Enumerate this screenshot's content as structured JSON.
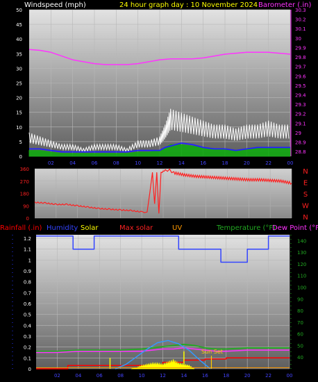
{
  "header": {
    "windspeed_label": "Windspeed (mph)",
    "title": "24 hour graph day : 10 November 2024",
    "barometer_label": "Barometer (.in)"
  },
  "colors": {
    "windspeed_label": "#ffffff",
    "title": "#ffff00",
    "barometer": "#ff33ff",
    "wind_gust": "#ffffff",
    "wind_avg": "#11aa11",
    "wind_dir_line": "#2222ff",
    "direction": "#ff2020",
    "rain": "#ff0000",
    "humidity": "#3344ff",
    "solar": "#ffff00",
    "max_solar": "#3399ff",
    "uv": "#ff9900",
    "temperature": "#22aa22",
    "dew_point": "#ff33ff",
    "sunset": "#ffcc00"
  },
  "chart_data": [
    {
      "type": "line",
      "name": "wind-barometer",
      "x_ticks": [
        "02",
        "04",
        "06",
        "08",
        "10",
        "12",
        "14",
        "16",
        "18",
        "20",
        "22",
        "00"
      ],
      "y_left": {
        "label": "Windspeed (mph)",
        "ticks": [
          "0",
          "5",
          "10",
          "15",
          "20",
          "25",
          "30",
          "35",
          "40",
          "45",
          "50"
        ],
        "lim": [
          0,
          50
        ]
      },
      "y_right": {
        "label": "Barometer (.in)",
        "ticks": [
          "28.8",
          "28.9",
          "29",
          "29.1",
          "29.2",
          "29.3",
          "29.4",
          "29.5",
          "29.6",
          "29.7",
          "29.8",
          "29.9",
          "30",
          "30.1",
          "30.2",
          "30.3"
        ],
        "lim": [
          28.75,
          30.3
        ]
      },
      "series": [
        {
          "key": "barometer",
          "axis": "right",
          "x": [
            0,
            1,
            2,
            3,
            4,
            5,
            6,
            7,
            8,
            9,
            10,
            11,
            12,
            13,
            14,
            15,
            16,
            17,
            18,
            19,
            20,
            21,
            22,
            23,
            24
          ],
          "values": [
            29.88,
            29.87,
            29.85,
            29.81,
            29.77,
            29.75,
            29.73,
            29.72,
            29.72,
            29.72,
            29.73,
            29.75,
            29.77,
            29.78,
            29.78,
            29.78,
            29.79,
            29.81,
            29.83,
            29.84,
            29.85,
            29.85,
            29.85,
            29.84,
            29.83
          ]
        },
        {
          "key": "wind_gust",
          "axis": "left",
          "x": [
            0,
            1,
            2,
            3,
            4,
            5,
            6,
            7,
            8,
            9,
            10,
            11,
            12,
            12.5,
            13,
            14,
            15,
            16,
            17,
            18,
            19,
            20,
            21,
            22,
            23,
            24
          ],
          "values": [
            6,
            5,
            4,
            3,
            3,
            2,
            3,
            3,
            3,
            2,
            4,
            4,
            5,
            8,
            12,
            11,
            10,
            9,
            8,
            8,
            7,
            8,
            8,
            9,
            8,
            8
          ]
        },
        {
          "key": "wind_avg",
          "axis": "left",
          "x": [
            0,
            1,
            2,
            3,
            4,
            5,
            6,
            7,
            8,
            9,
            10,
            11,
            12,
            12.5,
            13,
            14,
            15,
            16,
            17,
            18,
            19,
            20,
            21,
            22,
            23,
            24
          ],
          "values": [
            2,
            2,
            1.5,
            1,
            1,
            1,
            1,
            1,
            1,
            1,
            1.5,
            1.5,
            2,
            3,
            4,
            4,
            3.5,
            3,
            2.5,
            2.5,
            2,
            2.5,
            3,
            3,
            3,
            3
          ]
        },
        {
          "key": "wind_dir_line",
          "axis": "left",
          "x": [
            0,
            1,
            2,
            3,
            4,
            5,
            6,
            7,
            8,
            9,
            10,
            11,
            12,
            12.5,
            13,
            14,
            15,
            16,
            17,
            18,
            19,
            20,
            21,
            22,
            23,
            24
          ],
          "values": [
            2.5,
            2.5,
            2,
            1.5,
            1.5,
            1.5,
            1.5,
            1.5,
            1.5,
            1.5,
            2,
            2,
            2,
            3,
            3.5,
            4.5,
            4,
            3,
            2.5,
            2.5,
            2,
            2.5,
            3,
            3,
            3,
            3
          ]
        }
      ]
    },
    {
      "type": "line",
      "name": "wind-direction",
      "x_ticks": [
        "02",
        "04",
        "06",
        "08",
        "10",
        "12",
        "14",
        "16",
        "18",
        "20",
        "22",
        "00"
      ],
      "y_left": {
        "ticks": [
          "0",
          "90",
          "180",
          "270",
          "360"
        ],
        "lim": [
          0,
          360
        ]
      },
      "y_right": {
        "ticks": [
          "N",
          "W",
          "S",
          "E",
          "N"
        ]
      },
      "series": [
        {
          "key": "direction",
          "x": [
            0,
            1,
            2,
            3,
            4,
            5,
            6,
            7,
            8,
            9,
            10,
            10.5,
            11,
            11.2,
            11.4,
            11.6,
            11.8,
            12,
            12.2,
            12.6,
            13,
            14,
            15,
            16,
            17,
            18,
            19,
            20,
            21,
            22,
            23,
            24
          ],
          "values": [
            115,
            110,
            100,
            100,
            90,
            80,
            70,
            65,
            60,
            55,
            45,
            40,
            330,
            100,
            330,
            30,
            330,
            340,
            350,
            350,
            330,
            315,
            305,
            300,
            295,
            290,
            285,
            280,
            280,
            275,
            270,
            255
          ]
        }
      ]
    },
    {
      "type": "line",
      "name": "rain-humidity-temp",
      "x_ticks": [
        "02",
        "04",
        "06",
        "08",
        "10",
        "12",
        "14",
        "16",
        "18",
        "20",
        "22",
        "00"
      ],
      "y_left": {
        "label": "Rainfall (.in)",
        "ticks": [
          "0",
          "0.1",
          "0.2",
          "0.3",
          "0.4",
          "0.5",
          "0.6",
          "0.7",
          "0.8",
          "0.9",
          "1",
          "1.1",
          "1.2"
        ],
        "lim": [
          0,
          1.2
        ]
      },
      "y_right": {
        "label": "Temperature (°F)",
        "ticks": [
          "40",
          "50",
          "60",
          "70",
          "80",
          "90",
          "100",
          "110",
          "120",
          "130",
          "140"
        ],
        "lim": [
          30,
          145
        ]
      },
      "legend": [
        "Rainfall (.in)",
        "Humidity",
        "Solar",
        "Max solar",
        "UV",
        "Temperature (°F)",
        "Dew Point (°F)"
      ],
      "annotation": "Sun Set",
      "series": [
        {
          "key": "humidity",
          "axis": "none",
          "step": true,
          "x": [
            0,
            3.5,
            3.5,
            5.5,
            5.5,
            13.5,
            13.5,
            17.5,
            17.5,
            20,
            20,
            22,
            22,
            24
          ],
          "values": [
            1.22,
            1.22,
            1.1,
            1.1,
            1.22,
            1.22,
            1.1,
            1.1,
            0.98,
            0.98,
            1.1,
            1.1,
            1.22,
            1.22
          ]
        },
        {
          "key": "rain",
          "axis": "left",
          "step": true,
          "x": [
            0,
            3,
            3,
            12,
            12,
            14,
            14,
            16,
            16,
            18,
            18,
            24
          ],
          "values": [
            0,
            0,
            0.03,
            0.03,
            0.06,
            0.06,
            0.08,
            0.08,
            0.09,
            0.09,
            0.1,
            0.1
          ]
        },
        {
          "key": "temperature",
          "axis": "right",
          "x": [
            0,
            2,
            4,
            6,
            8,
            10,
            11,
            12,
            13,
            14,
            15,
            16,
            17,
            18,
            20,
            22,
            24
          ],
          "values": [
            45,
            45,
            46,
            46,
            46,
            47,
            48,
            49,
            50,
            51,
            50,
            48,
            47,
            47,
            48,
            48,
            48
          ]
        },
        {
          "key": "dew_point",
          "axis": "right",
          "x": [
            0,
            2,
            4,
            6,
            8,
            10,
            11,
            12,
            13,
            14,
            15,
            16,
            17,
            18,
            20,
            22,
            24
          ],
          "values": [
            44,
            44,
            45,
            45,
            45,
            45,
            46,
            47,
            47,
            48,
            47,
            46,
            45,
            45,
            46,
            46,
            46
          ]
        },
        {
          "key": "max_solar",
          "axis": "left",
          "x": [
            7.5,
            8.5,
            9.5,
            10.5,
            11.5,
            12.5,
            13.5,
            14.5,
            15.5,
            16.5
          ],
          "values": [
            0,
            0.04,
            0.11,
            0.18,
            0.24,
            0.26,
            0.23,
            0.17,
            0.08,
            0
          ]
        },
        {
          "key": "solar",
          "axis": "left",
          "x": [
            9,
            9.5,
            10,
            10.5,
            11,
            11.5,
            12,
            12.5,
            13,
            13.5,
            14,
            14.5,
            15
          ],
          "values": [
            0,
            0.01,
            0.03,
            0.04,
            0.05,
            0.05,
            0.04,
            0.06,
            0.08,
            0.05,
            0.04,
            0.03,
            0
          ]
        },
        {
          "key": "uv",
          "axis": "left",
          "x": [
            0,
            24
          ],
          "values": [
            0.01,
            0.01
          ]
        }
      ]
    }
  ]
}
